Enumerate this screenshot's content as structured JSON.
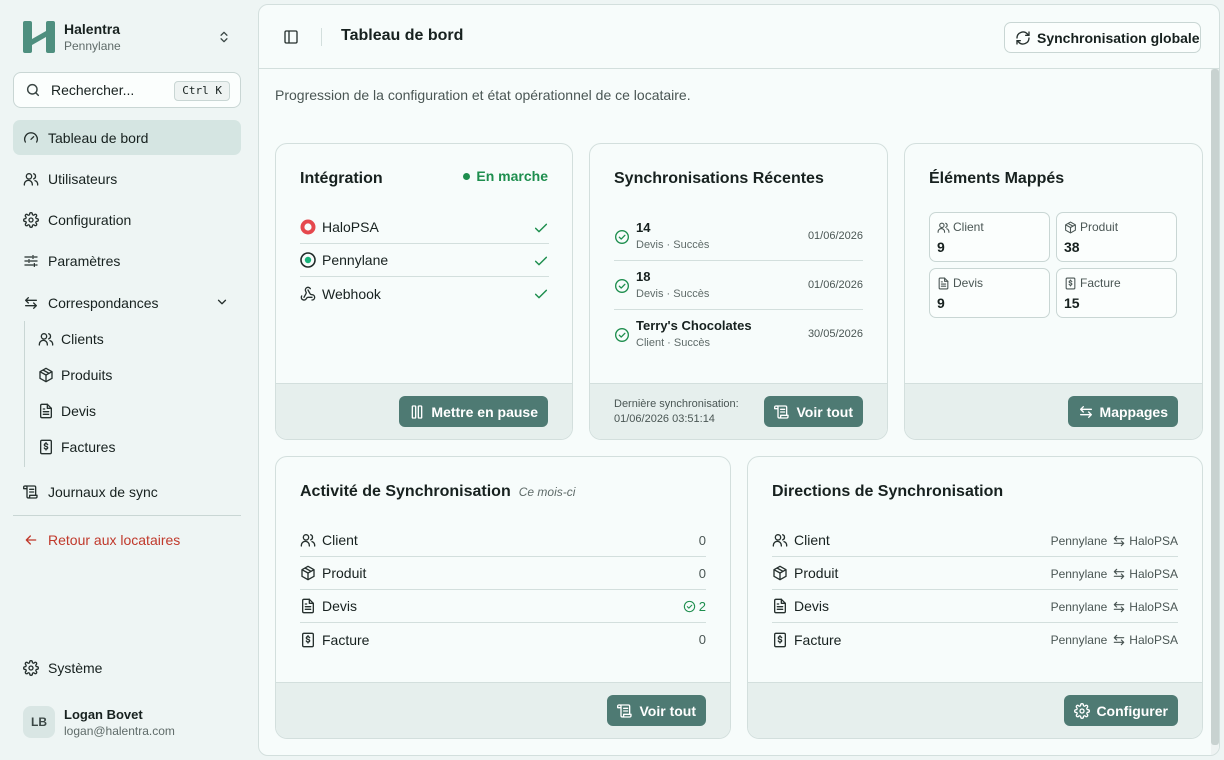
{
  "sidebar": {
    "brand_name": "Halentra",
    "brand_sub": "Pennylane",
    "search_placeholder": "Rechercher...",
    "search_shortcut": "Ctrl K",
    "nav": {
      "dashboard": "Tableau de bord",
      "users": "Utilisateurs",
      "configuration": "Configuration",
      "settings": "Paramètres",
      "mappings": "Correspondances",
      "clients": "Clients",
      "products": "Produits",
      "quotes": "Devis",
      "invoices": "Factures",
      "sync_logs": "Journaux de sync",
      "back": "Retour aux locataires",
      "system": "Système"
    },
    "user": {
      "initials": "LB",
      "name": "Logan Bovet",
      "email": "logan@halentra.com"
    }
  },
  "header": {
    "title": "Tableau de bord",
    "sync_button": "Synchronisation globale"
  },
  "subtitle": "Progression de la configuration et état opérationnel de ce locataire.",
  "integration": {
    "title": "Intégration",
    "status": "En marche",
    "items": [
      "HaloPSA",
      "Pennylane",
      "Webhook"
    ],
    "pause_button": "Mettre en pause"
  },
  "recent_syncs": {
    "title": "Synchronisations Récentes",
    "items": [
      {
        "name": "14",
        "meta": "Devis · Succès",
        "date": "01/06/2026"
      },
      {
        "name": "18",
        "meta": "Devis · Succès",
        "date": "01/06/2026"
      },
      {
        "name": "Terry's Chocolates",
        "meta": "Client · Succès",
        "date": "30/05/2026"
      }
    ],
    "last_sync_label": "Dernière synchronisation:",
    "last_sync_value": "01/06/2026 03:51:14",
    "view_all": "Voir tout"
  },
  "mapped": {
    "title": "Éléments Mappés",
    "tiles": [
      {
        "label": "Client",
        "value": "9"
      },
      {
        "label": "Produit",
        "value": "38"
      },
      {
        "label": "Devis",
        "value": "9"
      },
      {
        "label": "Facture",
        "value": "15"
      }
    ],
    "button": "Mappages"
  },
  "activity": {
    "title": "Activité de Synchronisation",
    "tag": "Ce mois-ci",
    "rows": [
      {
        "label": "Client",
        "count": "0"
      },
      {
        "label": "Produit",
        "count": "0"
      },
      {
        "label": "Devis",
        "count": "2"
      },
      {
        "label": "Facture",
        "count": "0"
      }
    ],
    "view_all": "Voir tout"
  },
  "directions": {
    "title": "Directions de Synchronisation",
    "rows": [
      {
        "label": "Client",
        "from": "Pennylane",
        "to": "HaloPSA"
      },
      {
        "label": "Produit",
        "from": "Pennylane",
        "to": "HaloPSA"
      },
      {
        "label": "Devis",
        "from": "Pennylane",
        "to": "HaloPSA"
      },
      {
        "label": "Facture",
        "from": "Pennylane",
        "to": "HaloPSA"
      }
    ],
    "button": "Configurer"
  },
  "colors": {
    "accent": "#4e7a73",
    "success": "#1e8e4e",
    "danger": "#c0392b",
    "active_bg": "#d5e5e2"
  }
}
